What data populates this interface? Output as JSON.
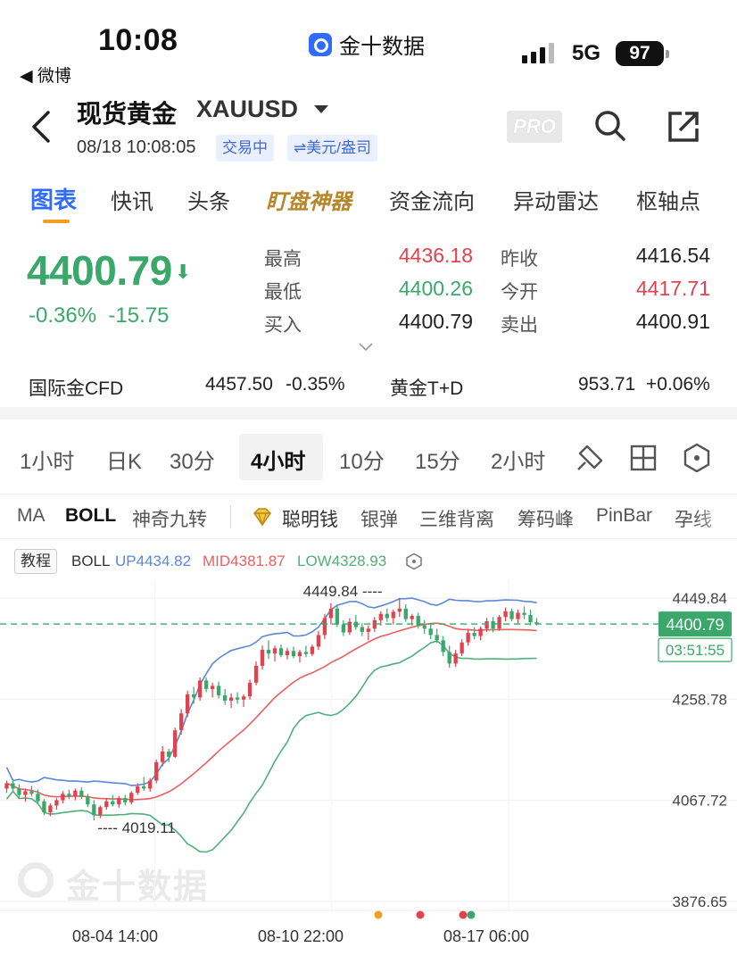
{
  "status_bar": {
    "time": "10:08",
    "back_app": "◀ 微博",
    "app_name": "金十数据",
    "network": "5G",
    "battery": "97"
  },
  "header": {
    "title": "现货黄金",
    "symbol": "XAUUSD",
    "datetime": "08/18 10:08:05",
    "status_badge": "交易中",
    "unit_badge": "⇌美元/盎司",
    "pro_label": "PRO"
  },
  "tabs": [
    "图表",
    "快讯",
    "头条",
    "盯盘神器",
    "资金流向",
    "异动雷达",
    "枢轴点"
  ],
  "quote": {
    "last": "4400.79",
    "change_pct": "-0.36%",
    "change": "-15.75",
    "high_label": "最高",
    "high": "4436.18",
    "low_label": "最低",
    "low": "4400.26",
    "bid_label": "买入",
    "bid": "4400.79",
    "prev_close_label": "昨收",
    "prev_close": "4416.54",
    "open_label": "今开",
    "open": "4417.71",
    "ask_label": "卖出",
    "ask": "4400.91"
  },
  "related": {
    "cfd_label": "国际金CFD",
    "cfd_price": "4457.50",
    "cfd_change": "-0.35%",
    "td_label": "黄金T+D",
    "td_price": "953.71",
    "td_change": "+0.06%"
  },
  "periods": [
    "1小时",
    "日K",
    "30分",
    "4小时",
    "10分",
    "15分",
    "2小时"
  ],
  "active_period": "4小时",
  "indicators": [
    "MA",
    "BOLL",
    "神奇九转",
    "聪明钱",
    "银弹",
    "三维背离",
    "筹码峰",
    "PinBar",
    "孕线"
  ],
  "chart_legend": {
    "tutorial": "教程",
    "name": "BOLL",
    "up": "UP4434.82",
    "mid": "MID4381.87",
    "low": "LOW4328.93"
  },
  "colors": {
    "up": "#e0424e",
    "down": "#3aa86b",
    "boll_up": "#5b87d8",
    "boll_mid": "#e86060",
    "boll_low": "#4fb07a",
    "accent": "#2f6bff"
  },
  "chart_data": {
    "type": "candlestick",
    "y_ticks": [
      "4449.84",
      "4258.78",
      "4067.72",
      "3876.65"
    ],
    "ylim": [
      3876.65,
      4449.84
    ],
    "x_ticks": [
      "08-04 14:00",
      "08-10 22:00",
      "08-17 06:00"
    ],
    "current_price": "4400.79",
    "countdown": "03:51:55",
    "max_label": "4449.84",
    "min_label": "4019.11",
    "watermark": "金十数据",
    "ohlc": [
      [
        4090,
        4105,
        4082,
        4100
      ],
      [
        4100,
        4108,
        4085,
        4090
      ],
      [
        4090,
        4098,
        4072,
        4078
      ],
      [
        4078,
        4090,
        4065,
        4085
      ],
      [
        4085,
        4095,
        4075,
        4080
      ],
      [
        4080,
        4088,
        4060,
        4066
      ],
      [
        4066,
        4070,
        4040,
        4045
      ],
      [
        4045,
        4062,
        4038,
        4058
      ],
      [
        4058,
        4072,
        4050,
        4068
      ],
      [
        4068,
        4085,
        4062,
        4080
      ],
      [
        4080,
        4088,
        4070,
        4075
      ],
      [
        4075,
        4090,
        4068,
        4086
      ],
      [
        4086,
        4092,
        4070,
        4074
      ],
      [
        4074,
        4080,
        4055,
        4060
      ],
      [
        4060,
        4068,
        4030,
        4040
      ],
      [
        4040,
        4058,
        4034,
        4055
      ],
      [
        4055,
        4072,
        4050,
        4066
      ],
      [
        4066,
        4078,
        4056,
        4060
      ],
      [
        4060,
        4076,
        4054,
        4072
      ],
      [
        4072,
        4078,
        4058,
        4064
      ],
      [
        4064,
        4085,
        4060,
        4082
      ],
      [
        4082,
        4100,
        4078,
        4094
      ],
      [
        4094,
        4112,
        4086,
        4090
      ],
      [
        4090,
        4110,
        4084,
        4105
      ],
      [
        4105,
        4145,
        4100,
        4140
      ],
      [
        4140,
        4170,
        4132,
        4160
      ],
      [
        4160,
        4165,
        4140,
        4150
      ],
      [
        4150,
        4205,
        4148,
        4200
      ],
      [
        4200,
        4240,
        4192,
        4232
      ],
      [
        4232,
        4275,
        4225,
        4268
      ],
      [
        4268,
        4282,
        4250,
        4262
      ],
      [
        4262,
        4300,
        4256,
        4294
      ],
      [
        4294,
        4300,
        4272,
        4278
      ],
      [
        4278,
        4290,
        4262,
        4284
      ],
      [
        4284,
        4292,
        4260,
        4266
      ],
      [
        4266,
        4278,
        4248,
        4256
      ],
      [
        4256,
        4270,
        4242,
        4262
      ],
      [
        4262,
        4272,
        4250,
        4258
      ],
      [
        4258,
        4268,
        4244,
        4264
      ],
      [
        4264,
        4296,
        4258,
        4290
      ],
      [
        4290,
        4330,
        4285,
        4322
      ],
      [
        4322,
        4360,
        4315,
        4352
      ],
      [
        4352,
        4370,
        4335,
        4345
      ],
      [
        4345,
        4360,
        4330,
        4355
      ],
      [
        4355,
        4362,
        4338,
        4342
      ],
      [
        4342,
        4356,
        4334,
        4350
      ],
      [
        4350,
        4358,
        4336,
        4340
      ],
      [
        4340,
        4352,
        4328,
        4348
      ],
      [
        4348,
        4360,
        4338,
        4344
      ],
      [
        4344,
        4362,
        4340,
        4358
      ],
      [
        4358,
        4388,
        4352,
        4380
      ],
      [
        4380,
        4420,
        4372,
        4412
      ],
      [
        4412,
        4440,
        4400,
        4430
      ],
      [
        4430,
        4436,
        4395,
        4400
      ],
      [
        4400,
        4408,
        4378,
        4385
      ],
      [
        4385,
        4412,
        4380,
        4405
      ],
      [
        4405,
        4418,
        4390,
        4395
      ],
      [
        4395,
        4402,
        4378,
        4386
      ],
      [
        4386,
        4398,
        4370,
        4392
      ],
      [
        4392,
        4414,
        4386,
        4408
      ],
      [
        4408,
        4425,
        4398,
        4420
      ],
      [
        4420,
        4430,
        4405,
        4412
      ],
      [
        4412,
        4428,
        4400,
        4424
      ],
      [
        4424,
        4449.84,
        4414,
        4430
      ],
      [
        4430,
        4438,
        4405,
        4410
      ],
      [
        4410,
        4420,
        4398,
        4416
      ],
      [
        4416,
        4422,
        4392,
        4398
      ],
      [
        4398,
        4408,
        4382,
        4392
      ],
      [
        4392,
        4400,
        4372,
        4380
      ],
      [
        4380,
        4392,
        4365,
        4370
      ],
      [
        4370,
        4378,
        4340,
        4348
      ],
      [
        4348,
        4360,
        4318,
        4326
      ],
      [
        4326,
        4352,
        4320,
        4345
      ],
      [
        4345,
        4372,
        4340,
        4366
      ],
      [
        4366,
        4390,
        4360,
        4384
      ],
      [
        4384,
        4395,
        4372,
        4378
      ],
      [
        4378,
        4396,
        4370,
        4392
      ],
      [
        4392,
        4412,
        4386,
        4406
      ],
      [
        4406,
        4414,
        4385,
        4392
      ],
      [
        4392,
        4418,
        4388,
        4414
      ],
      [
        4414,
        4432,
        4406,
        4425
      ],
      [
        4425,
        4430,
        4406,
        4410
      ],
      [
        4410,
        4428,
        4402,
        4422
      ],
      [
        4422,
        4434,
        4410,
        4418
      ],
      [
        4418,
        4428,
        4398,
        4404
      ],
      [
        4404,
        4412,
        4398,
        4400.79
      ]
    ]
  }
}
